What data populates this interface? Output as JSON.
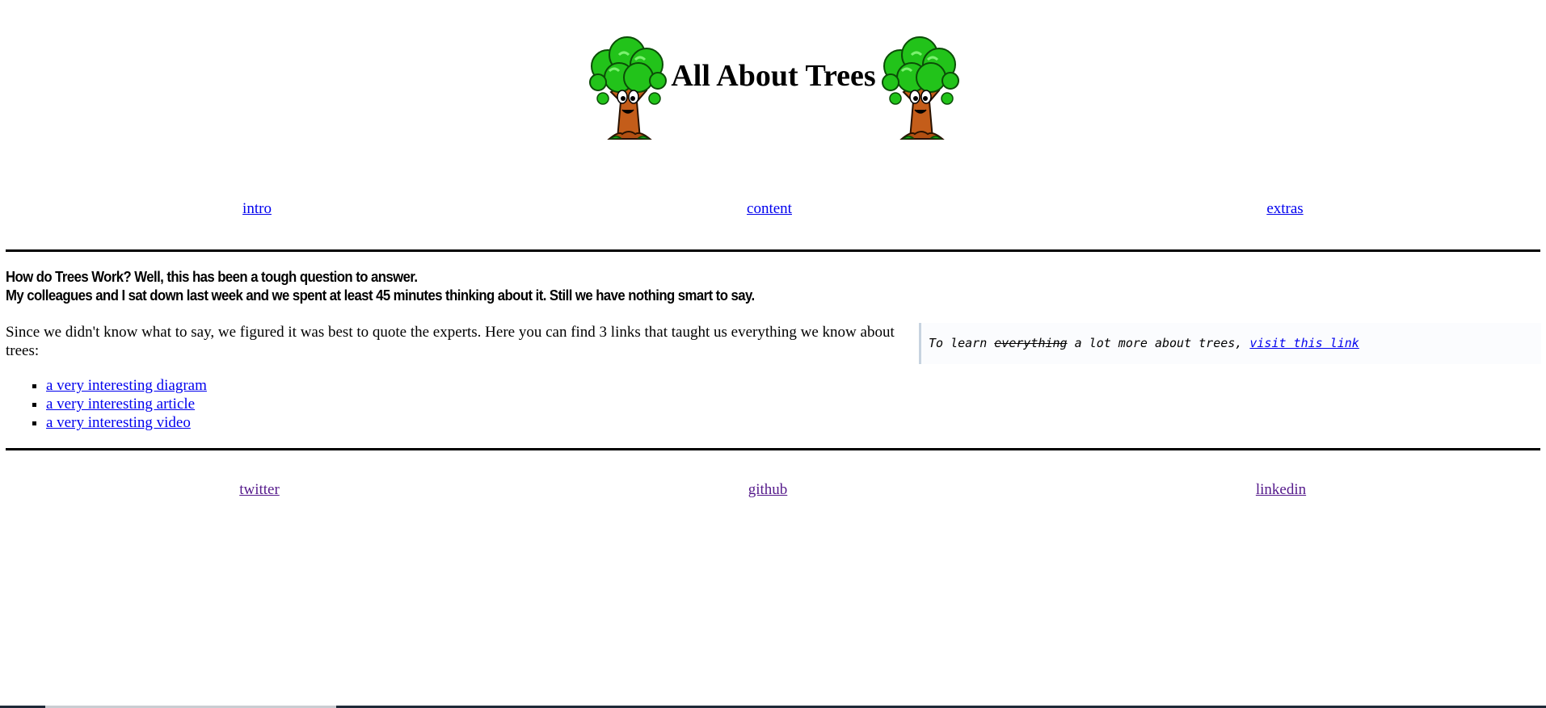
{
  "header": {
    "title": "All About Trees",
    "logo_icon": "tree-mascot-icon"
  },
  "nav": {
    "intro": "intro",
    "content": "content",
    "extras": "extras"
  },
  "content": {
    "question_line1": "How do Trees Work? Well, this has been a tough question to answer.",
    "question_line2": "My colleagues and I sat down last week and we spent at least 45 minutes thinking about it. Still we have nothing smart to say.",
    "intro": "Since we didn't know what to say, we figured it was best to quote the experts. Here you can find 3 links that taught us everything we know about trees:",
    "links": [
      "a very interesting diagram",
      "a very interesting article",
      "a very interesting video"
    ]
  },
  "callout": {
    "prefix": "To learn",
    "struck": "everything",
    "middle": "a lot more about trees,",
    "link": "visit this link"
  },
  "footer": {
    "twitter": "twitter",
    "github": "github",
    "linkedin": "linkedin"
  },
  "colors": {
    "link": "#0000ee",
    "visited": "#551a8b",
    "tree_leaves": "#22c31a",
    "tree_trunk": "#c45d1a"
  }
}
